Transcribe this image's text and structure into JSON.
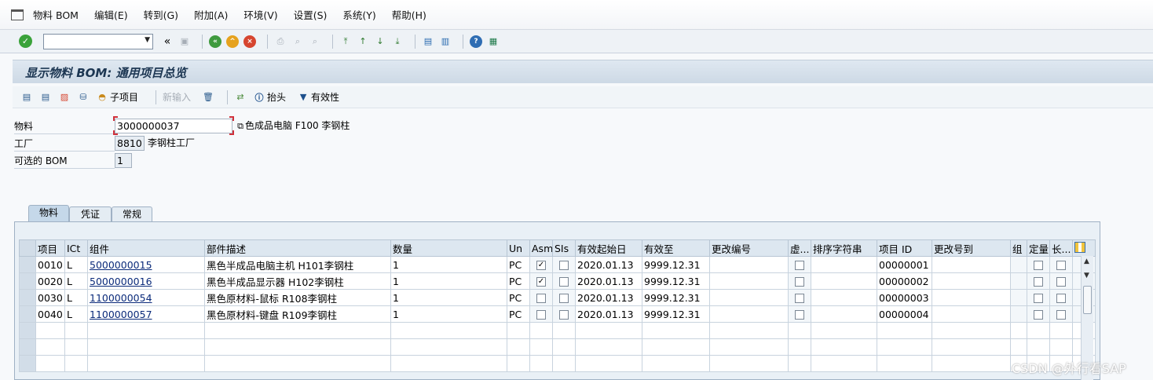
{
  "menu": [
    "物料 BOM",
    "编辑(E)",
    "转到(G)",
    "附加(A)",
    "环境(V)",
    "设置(S)",
    "系统(Y)",
    "帮助(H)"
  ],
  "screen_title": "显示物料 BOM: 通用项目总览",
  "app_toolbar": {
    "sub_item": "子项目",
    "new_entry": "新输入",
    "header": "抬头",
    "validity": "有效性"
  },
  "header_fields": {
    "material_label": "物料",
    "material_value": "3000000037",
    "material_desc": "色成品电脑 F100 李钢柱",
    "plant_label": "工厂",
    "plant_value": "8810",
    "plant_desc": "李钢柱工厂",
    "alt_bom_label": "可选的 BOM",
    "alt_bom_value": "1"
  },
  "tabs": [
    "物料",
    "凭证",
    "常规"
  ],
  "table": {
    "columns": [
      "项目",
      "ICt",
      "组件",
      "部件描述",
      "数量",
      "Un",
      "Asm",
      "SIs",
      "有效起始日",
      "有效至",
      "更改编号",
      "虚...",
      "排序字符串",
      "项目 ID",
      "更改号到",
      "组",
      "定量",
      "长..."
    ],
    "rows": [
      {
        "item": "0010",
        "ict": "L",
        "component": "5000000015",
        "desc": "黑色半成品电脑主机 H101李钢柱",
        "qty": "1",
        "un": "PC",
        "asm": true,
        "valid_from": "2020.01.13",
        "valid_to": "9999.12.31",
        "item_id": "00000001"
      },
      {
        "item": "0020",
        "ict": "L",
        "component": "5000000016",
        "desc": "黑色半成品显示器 H102李钢柱",
        "qty": "1",
        "un": "PC",
        "asm": true,
        "valid_from": "2020.01.13",
        "valid_to": "9999.12.31",
        "item_id": "00000002"
      },
      {
        "item": "0030",
        "ict": "L",
        "component": "1100000054",
        "desc": "黑色原材料-鼠标 R108李钢柱",
        "qty": "1",
        "un": "PC",
        "asm": false,
        "valid_from": "2020.01.13",
        "valid_to": "9999.12.31",
        "item_id": "00000003"
      },
      {
        "item": "0040",
        "ict": "L",
        "component": "1100000057",
        "desc": "黑色原材料-键盘 R109李钢柱",
        "qty": "1",
        "un": "PC",
        "asm": false,
        "valid_from": "2020.01.13",
        "valid_to": "9999.12.31",
        "item_id": "00000004"
      }
    ],
    "empty_rows": 3
  },
  "watermark": "CSDN @外行看SAP"
}
